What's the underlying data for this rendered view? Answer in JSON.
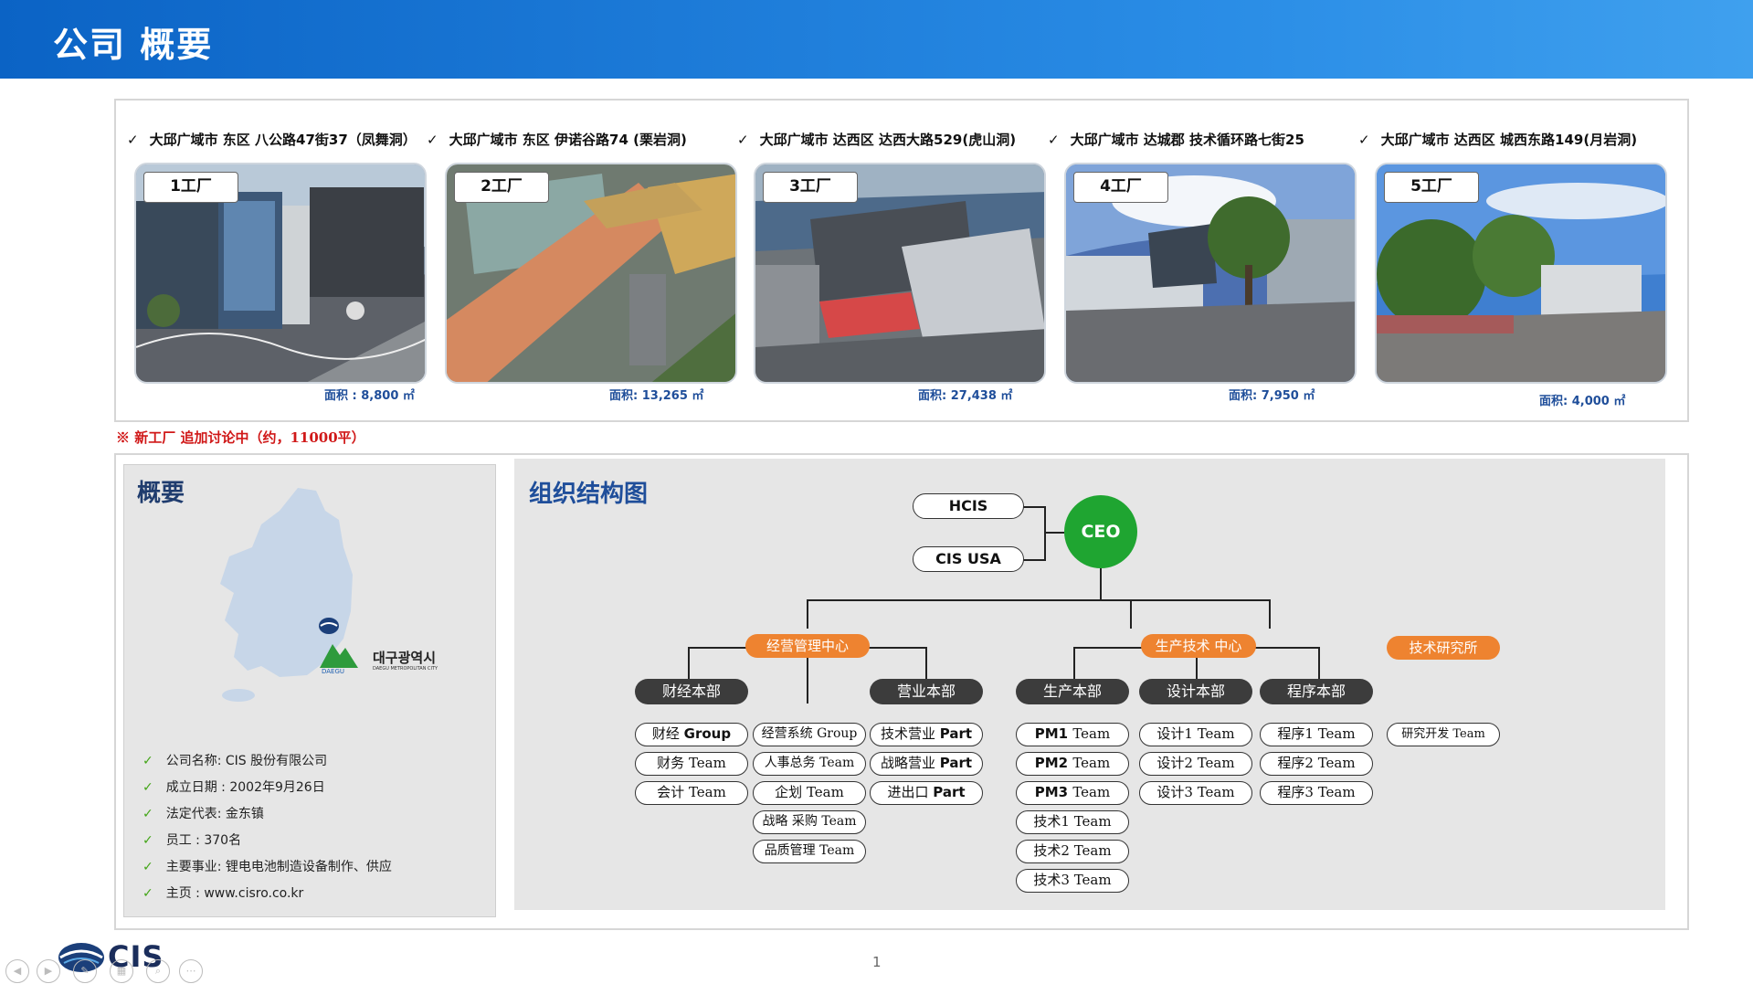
{
  "header": {
    "title": "公司 概要"
  },
  "factories": [
    {
      "address": "大邱广域市 东区 八公路47街37（凤舞洞）",
      "tag": "1工厂",
      "area": "面积 : 8,800 ㎡"
    },
    {
      "address": "大邱广域市 东区 伊诺谷路74 (栗岩洞)",
      "tag": "2工厂",
      "area": "面积: 13,265 ㎡"
    },
    {
      "address": "大邱广域市 达西区 达西大路529(虎山洞)",
      "tag": "3工厂",
      "area": "面积: 27,438 ㎡"
    },
    {
      "address": "大邱广域市 达城郡 技术循环路七街25",
      "tag": "4工厂",
      "area": "面积: 7,950 ㎡"
    },
    {
      "address": "大邱广域市 达西区 城西东路149(月岩洞)",
      "tag": "5工厂",
      "area": "面积: 4,000 ㎡"
    }
  ],
  "note": "※ 新工厂  追加讨论中（约，11000平）",
  "summary": {
    "title": "概要",
    "city_label": "대구광역시",
    "city_sub": "DAEGU METROPOLITAN CITY",
    "map_logo_text": "DAEGU",
    "items": [
      "公司名称: CIS 股份有限公司",
      "成立日期 : 2002年9月26日",
      "法定代表: 金东镇",
      "员工 : 370名",
      "主要事业: 锂电电池制造设备制作、供应",
      "主页 : www.cisro.co.kr"
    ]
  },
  "org": {
    "title": "组织结构图",
    "hcis": "HCIS",
    "cis_usa": "CIS USA",
    "ceo": "CEO",
    "center1": "经营管理中心",
    "center2": "生产技术 中心",
    "center3": "技术研究所",
    "dept_finance": "财经本部",
    "dept_sales": "营业本部",
    "dept_production": "生产本部",
    "dept_design": "设计本部",
    "dept_program": "程序本部",
    "finance_col": [
      {
        "zh": "财经 ",
        "en": "Group"
      },
      {
        "zh": "财务 ",
        "en": "Team"
      },
      {
        "zh": "会计 ",
        "en": "Team"
      }
    ],
    "mgmt_col": [
      {
        "zh": "经营系统 ",
        "en": "Group"
      },
      {
        "zh": "人事总务 ",
        "en": "Team"
      },
      {
        "zh": "企划 ",
        "en": "Team"
      },
      {
        "zh": "战略 采购 ",
        "en": "Team"
      },
      {
        "zh": "品质管理 ",
        "en": "Team"
      }
    ],
    "sales_col": [
      {
        "zh": "技术营业 ",
        "en": "Part"
      },
      {
        "zh": "战略营业 ",
        "en": "Part"
      },
      {
        "zh": "进出口 ",
        "en": "Part"
      }
    ],
    "production_col": [
      {
        "zh": "PM1 ",
        "en": "Team"
      },
      {
        "zh": "PM2 ",
        "en": "Team"
      },
      {
        "zh": "PM3 ",
        "en": "Team"
      },
      {
        "zh": "技术1 ",
        "en": "Team"
      },
      {
        "zh": "技术2 ",
        "en": "Team"
      },
      {
        "zh": "技术3 ",
        "en": "Team"
      }
    ],
    "design_col": [
      {
        "zh": "设计1 ",
        "en": "Team"
      },
      {
        "zh": "设计2 ",
        "en": "Team"
      },
      {
        "zh": "设计3 ",
        "en": "Team"
      }
    ],
    "program_col": [
      {
        "zh": "程序1 ",
        "en": "Team"
      },
      {
        "zh": "程序2 ",
        "en": "Team"
      },
      {
        "zh": "程序3 ",
        "en": "Team"
      }
    ],
    "rnd_col": [
      {
        "zh": "研究开发 ",
        "en": "Team"
      }
    ]
  },
  "footer": {
    "logo_text": "CIS",
    "page_number": "1"
  },
  "colors": {
    "header_blue": "#0b63c5",
    "ceo_green": "#1fa531",
    "center_orange": "#ee8330",
    "dept_dark": "#3c3c3c",
    "note_red": "#d01818"
  },
  "icons": [
    "checkmark-icon",
    "korea-map-icon",
    "daegu-logo-icon",
    "cis-logo-icon",
    "slide-nav-icons"
  ]
}
